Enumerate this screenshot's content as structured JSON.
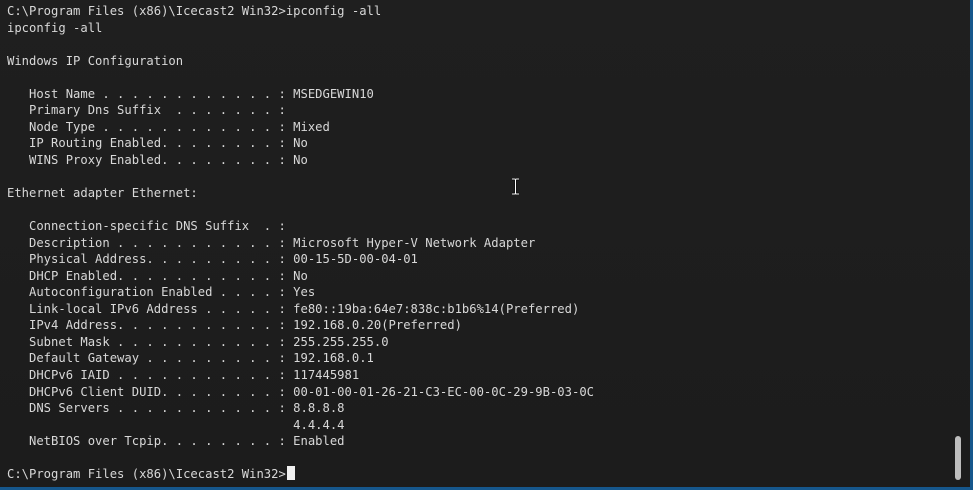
{
  "window": {
    "accent_color": "#16578c",
    "background_color": "#1e1e1e",
    "text_color": "#d8d8d8"
  },
  "terminal": {
    "lines": [
      "C:\\Program Files (x86)\\Icecast2 Win32>ipconfig -all",
      "ipconfig -all",
      "",
      "Windows IP Configuration",
      "",
      "   Host Name . . . . . . . . . . . . : MSEDGEWIN10",
      "   Primary Dns Suffix  . . . . . . . :",
      "   Node Type . . . . . . . . . . . . : Mixed",
      "   IP Routing Enabled. . . . . . . . : No",
      "   WINS Proxy Enabled. . . . . . . . : No",
      "",
      "Ethernet adapter Ethernet:",
      "",
      "   Connection-specific DNS Suffix  . :",
      "   Description . . . . . . . . . . . : Microsoft Hyper-V Network Adapter",
      "   Physical Address. . . . . . . . . : 00-15-5D-00-04-01",
      "   DHCP Enabled. . . . . . . . . . . : No",
      "   Autoconfiguration Enabled . . . . : Yes",
      "   Link-local IPv6 Address . . . . . : fe80::19ba:64e7:838c:b1b6%14(Preferred)",
      "   IPv4 Address. . . . . . . . . . . : 192.168.0.20(Preferred)",
      "   Subnet Mask . . . . . . . . . . . : 255.255.255.0",
      "   Default Gateway . . . . . . . . . : 192.168.0.1",
      "   DHCPv6 IAID . . . . . . . . . . . : 117445981",
      "   DHCPv6 Client DUID. . . . . . . . : 00-01-00-01-26-21-C3-EC-00-0C-29-9B-03-0C",
      "   DNS Servers . . . . . . . . . . . : 8.8.8.8",
      "                                       4.4.4.4",
      "   NetBIOS over Tcpip. . . . . . . . : Enabled",
      ""
    ],
    "prompt": "C:\\Program Files (x86)\\Icecast2 Win32>",
    "cursor_icon": "block-cursor",
    "pointer_icon": "text-ibeam-icon",
    "scroll_position": 1.0
  }
}
